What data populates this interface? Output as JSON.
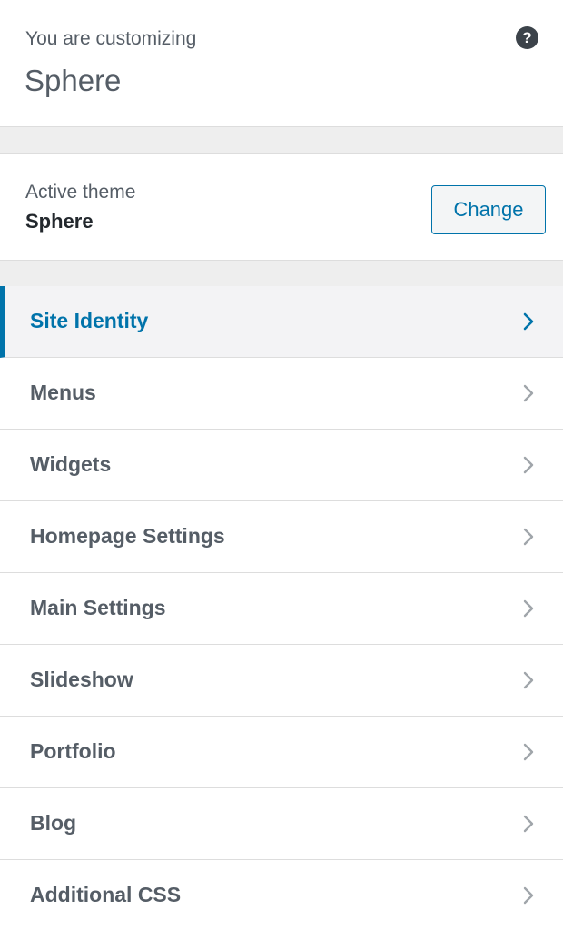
{
  "header": {
    "info_label": "You are customizing",
    "site_title": "Sphere",
    "help_icon": "help-icon"
  },
  "active_theme": {
    "label": "Active theme",
    "name": "Sphere",
    "change_label": "Change"
  },
  "sections": [
    {
      "label": "Site Identity",
      "active": true
    },
    {
      "label": "Menus"
    },
    {
      "label": "Widgets"
    },
    {
      "label": "Homepage Settings"
    },
    {
      "label": "Main Settings"
    },
    {
      "label": "Slideshow"
    },
    {
      "label": "Portfolio"
    },
    {
      "label": "Blog"
    },
    {
      "label": "Additional CSS"
    }
  ],
  "colors": {
    "accent": "#0073aa",
    "chevron": "#a0a5aa",
    "chevron_active": "#0073aa",
    "text": "#555d66"
  }
}
